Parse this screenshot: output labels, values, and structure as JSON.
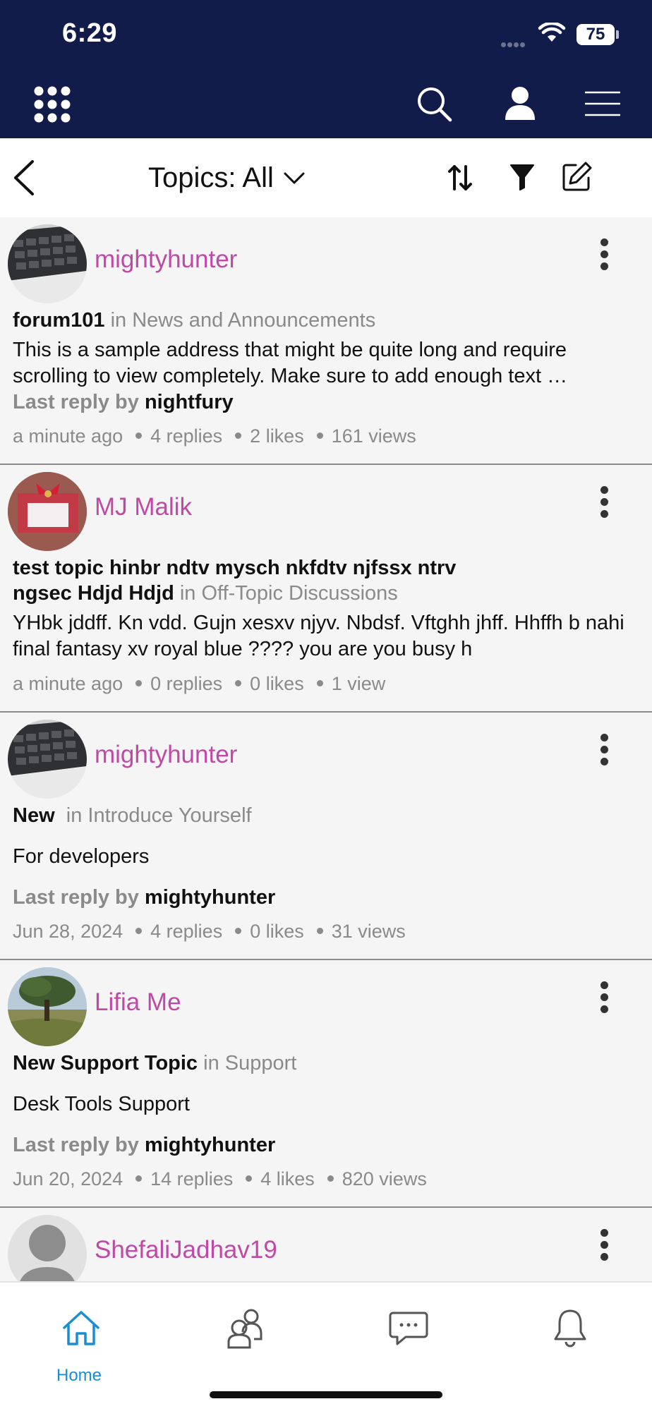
{
  "status_bar": {
    "time": "6:29",
    "battery": "75"
  },
  "toolbar": {
    "topics_label": "Topics: All"
  },
  "topics": [
    {
      "username": "mightyhunter",
      "title": "forum101",
      "category": "in News and Announcements",
      "excerpt": "This is a sample address that might be quite long and require scrolling to view completely. Make sure to add enough text …",
      "last_reply_prefix": "Last reply by",
      "last_reply_user": "nightfury",
      "time": "a minute ago",
      "replies": "4 replies",
      "likes": "2 likes",
      "views": "161 views"
    },
    {
      "username": "MJ Malik",
      "title": "test topic hinbr ndtv mysch nkfdtv njfssx ntrv ngsec Hdjd Hdjd",
      "category": "in Off-Topic Discussions",
      "excerpt": "YHbk jddff. Kn vdd. Gujn xesxv njyv. Nbdsf. Vftghh jhff. Hhffh b nahi final fantasy xv royal blue ???? you are you busy h",
      "time": "a minute ago",
      "replies": "0 replies",
      "likes": "0 likes",
      "views": "1 view"
    },
    {
      "username": "mightyhunter",
      "title": "New",
      "category": "in Introduce Yourself",
      "excerpt": "For developers",
      "last_reply_prefix": "Last reply by",
      "last_reply_user": "mightyhunter",
      "time": "Jun 28, 2024",
      "replies": "4 replies",
      "likes": "0 likes",
      "views": "31 views"
    },
    {
      "username": "Lifia Me",
      "title": "New Support Topic",
      "category": "in Support",
      "excerpt": "Desk Tools Support",
      "last_reply_prefix": "Last reply by",
      "last_reply_user": "mightyhunter",
      "time": "Jun 20, 2024",
      "replies": "14 replies",
      "likes": "4 likes",
      "views": "820 views"
    },
    {
      "username": "ShefaliJadhav19"
    }
  ],
  "tab_bar": {
    "home_label": "Home"
  },
  "colors": {
    "header_bg": "#121c4a",
    "username": "#bf4aa6",
    "active_tab": "#1a8ed1",
    "muted_text": "#8a8a8a"
  },
  "icons": [
    "grid-icon",
    "search-icon",
    "user-icon",
    "menu-icon",
    "back-icon",
    "chevron-down-icon",
    "sort-icon",
    "filter-icon",
    "compose-icon",
    "more-icon",
    "home-icon",
    "groups-icon",
    "chat-icon",
    "bell-icon"
  ]
}
